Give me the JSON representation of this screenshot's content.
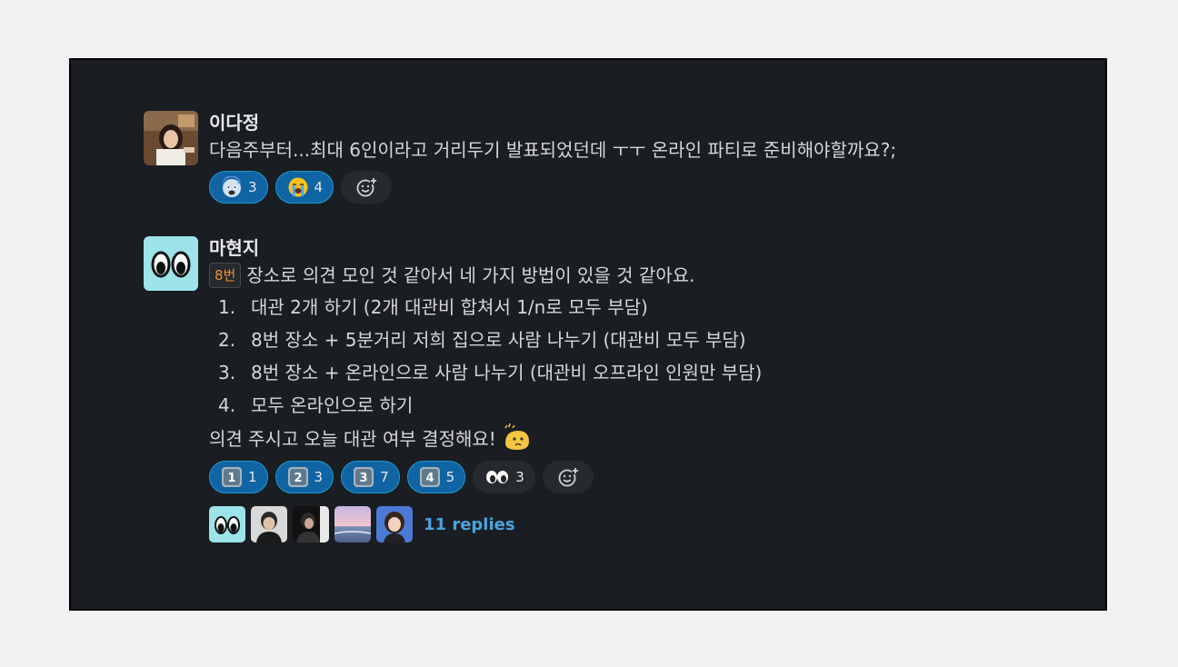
{
  "messages": [
    {
      "author": "이다정",
      "text": "다음주부터...최대 6인이라고 거리두기 발표되었던데 ㅜㅜ 온라인 파티로 준비해야할까요?;",
      "reactions": [
        {
          "icon": "cold-sweat-emoji",
          "count": "3"
        },
        {
          "icon": "sob-emoji",
          "count": "4"
        }
      ]
    },
    {
      "author": "마현지",
      "tag": "8번",
      "intro": "장소로 의견 모인 것 같아서 네 가지 방법이 있을 것 같아요.",
      "items": [
        {
          "num": "1.",
          "text": "대관 2개 하기 (2개 대관비 합쳐서 1/n로 모두 부담)"
        },
        {
          "num": "2.",
          "text": "8번 장소 + 5분거리 저희 집으로 사람 나누기 (대관비 모두 부담)"
        },
        {
          "num": "3.",
          "text": "8번 장소 + 온라인으로 사람 나누기 (대관비 오프라인 인원만 부담)"
        },
        {
          "num": "4.",
          "text": "모두 온라인으로 하기"
        }
      ],
      "outro": "의견 주시고 오늘 대관 여부 결정해요!",
      "reactions": [
        {
          "icon": "keycap-1-emoji",
          "label": "1",
          "count": "1"
        },
        {
          "icon": "keycap-2-emoji",
          "label": "2",
          "count": "3"
        },
        {
          "icon": "keycap-3-emoji",
          "label": "3",
          "count": "7"
        },
        {
          "icon": "keycap-4-emoji",
          "label": "4",
          "count": "5"
        },
        {
          "icon": "eyes-emoji",
          "count": "3"
        }
      ],
      "replies_label": "11 replies"
    }
  ],
  "colors": {
    "background": "#1a1d21",
    "reaction_active": "#1164a3",
    "link": "#4aa3df",
    "tag": "#e8912d"
  }
}
